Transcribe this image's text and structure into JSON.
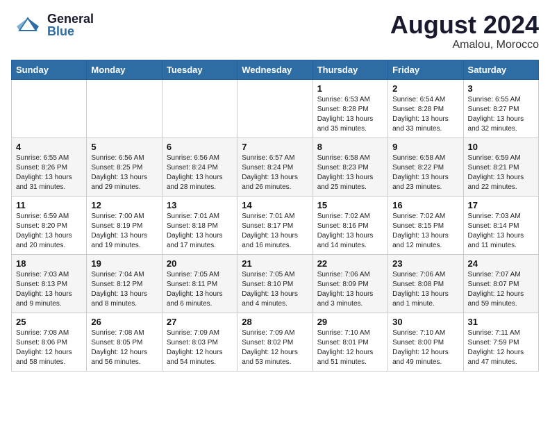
{
  "header": {
    "logo_general": "General",
    "logo_blue": "Blue",
    "title": "August 2024",
    "subtitle": "Amalou, Morocco"
  },
  "calendar": {
    "days_of_week": [
      "Sunday",
      "Monday",
      "Tuesday",
      "Wednesday",
      "Thursday",
      "Friday",
      "Saturday"
    ],
    "weeks": [
      [
        {
          "day": "",
          "info": ""
        },
        {
          "day": "",
          "info": ""
        },
        {
          "day": "",
          "info": ""
        },
        {
          "day": "",
          "info": ""
        },
        {
          "day": "1",
          "info": "Sunrise: 6:53 AM\nSunset: 8:28 PM\nDaylight: 13 hours\nand 35 minutes."
        },
        {
          "day": "2",
          "info": "Sunrise: 6:54 AM\nSunset: 8:28 PM\nDaylight: 13 hours\nand 33 minutes."
        },
        {
          "day": "3",
          "info": "Sunrise: 6:55 AM\nSunset: 8:27 PM\nDaylight: 13 hours\nand 32 minutes."
        }
      ],
      [
        {
          "day": "4",
          "info": "Sunrise: 6:55 AM\nSunset: 8:26 PM\nDaylight: 13 hours\nand 31 minutes."
        },
        {
          "day": "5",
          "info": "Sunrise: 6:56 AM\nSunset: 8:25 PM\nDaylight: 13 hours\nand 29 minutes."
        },
        {
          "day": "6",
          "info": "Sunrise: 6:56 AM\nSunset: 8:24 PM\nDaylight: 13 hours\nand 28 minutes."
        },
        {
          "day": "7",
          "info": "Sunrise: 6:57 AM\nSunset: 8:24 PM\nDaylight: 13 hours\nand 26 minutes."
        },
        {
          "day": "8",
          "info": "Sunrise: 6:58 AM\nSunset: 8:23 PM\nDaylight: 13 hours\nand 25 minutes."
        },
        {
          "day": "9",
          "info": "Sunrise: 6:58 AM\nSunset: 8:22 PM\nDaylight: 13 hours\nand 23 minutes."
        },
        {
          "day": "10",
          "info": "Sunrise: 6:59 AM\nSunset: 8:21 PM\nDaylight: 13 hours\nand 22 minutes."
        }
      ],
      [
        {
          "day": "11",
          "info": "Sunrise: 6:59 AM\nSunset: 8:20 PM\nDaylight: 13 hours\nand 20 minutes."
        },
        {
          "day": "12",
          "info": "Sunrise: 7:00 AM\nSunset: 8:19 PM\nDaylight: 13 hours\nand 19 minutes."
        },
        {
          "day": "13",
          "info": "Sunrise: 7:01 AM\nSunset: 8:18 PM\nDaylight: 13 hours\nand 17 minutes."
        },
        {
          "day": "14",
          "info": "Sunrise: 7:01 AM\nSunset: 8:17 PM\nDaylight: 13 hours\nand 16 minutes."
        },
        {
          "day": "15",
          "info": "Sunrise: 7:02 AM\nSunset: 8:16 PM\nDaylight: 13 hours\nand 14 minutes."
        },
        {
          "day": "16",
          "info": "Sunrise: 7:02 AM\nSunset: 8:15 PM\nDaylight: 13 hours\nand 12 minutes."
        },
        {
          "day": "17",
          "info": "Sunrise: 7:03 AM\nSunset: 8:14 PM\nDaylight: 13 hours\nand 11 minutes."
        }
      ],
      [
        {
          "day": "18",
          "info": "Sunrise: 7:03 AM\nSunset: 8:13 PM\nDaylight: 13 hours\nand 9 minutes."
        },
        {
          "day": "19",
          "info": "Sunrise: 7:04 AM\nSunset: 8:12 PM\nDaylight: 13 hours\nand 8 minutes."
        },
        {
          "day": "20",
          "info": "Sunrise: 7:05 AM\nSunset: 8:11 PM\nDaylight: 13 hours\nand 6 minutes."
        },
        {
          "day": "21",
          "info": "Sunrise: 7:05 AM\nSunset: 8:10 PM\nDaylight: 13 hours\nand 4 minutes."
        },
        {
          "day": "22",
          "info": "Sunrise: 7:06 AM\nSunset: 8:09 PM\nDaylight: 13 hours\nand 3 minutes."
        },
        {
          "day": "23",
          "info": "Sunrise: 7:06 AM\nSunset: 8:08 PM\nDaylight: 13 hours\nand 1 minute."
        },
        {
          "day": "24",
          "info": "Sunrise: 7:07 AM\nSunset: 8:07 PM\nDaylight: 12 hours\nand 59 minutes."
        }
      ],
      [
        {
          "day": "25",
          "info": "Sunrise: 7:08 AM\nSunset: 8:06 PM\nDaylight: 12 hours\nand 58 minutes."
        },
        {
          "day": "26",
          "info": "Sunrise: 7:08 AM\nSunset: 8:05 PM\nDaylight: 12 hours\nand 56 minutes."
        },
        {
          "day": "27",
          "info": "Sunrise: 7:09 AM\nSunset: 8:03 PM\nDaylight: 12 hours\nand 54 minutes."
        },
        {
          "day": "28",
          "info": "Sunrise: 7:09 AM\nSunset: 8:02 PM\nDaylight: 12 hours\nand 53 minutes."
        },
        {
          "day": "29",
          "info": "Sunrise: 7:10 AM\nSunset: 8:01 PM\nDaylight: 12 hours\nand 51 minutes."
        },
        {
          "day": "30",
          "info": "Sunrise: 7:10 AM\nSunset: 8:00 PM\nDaylight: 12 hours\nand 49 minutes."
        },
        {
          "day": "31",
          "info": "Sunrise: 7:11 AM\nSunset: 7:59 PM\nDaylight: 12 hours\nand 47 minutes."
        }
      ]
    ]
  }
}
